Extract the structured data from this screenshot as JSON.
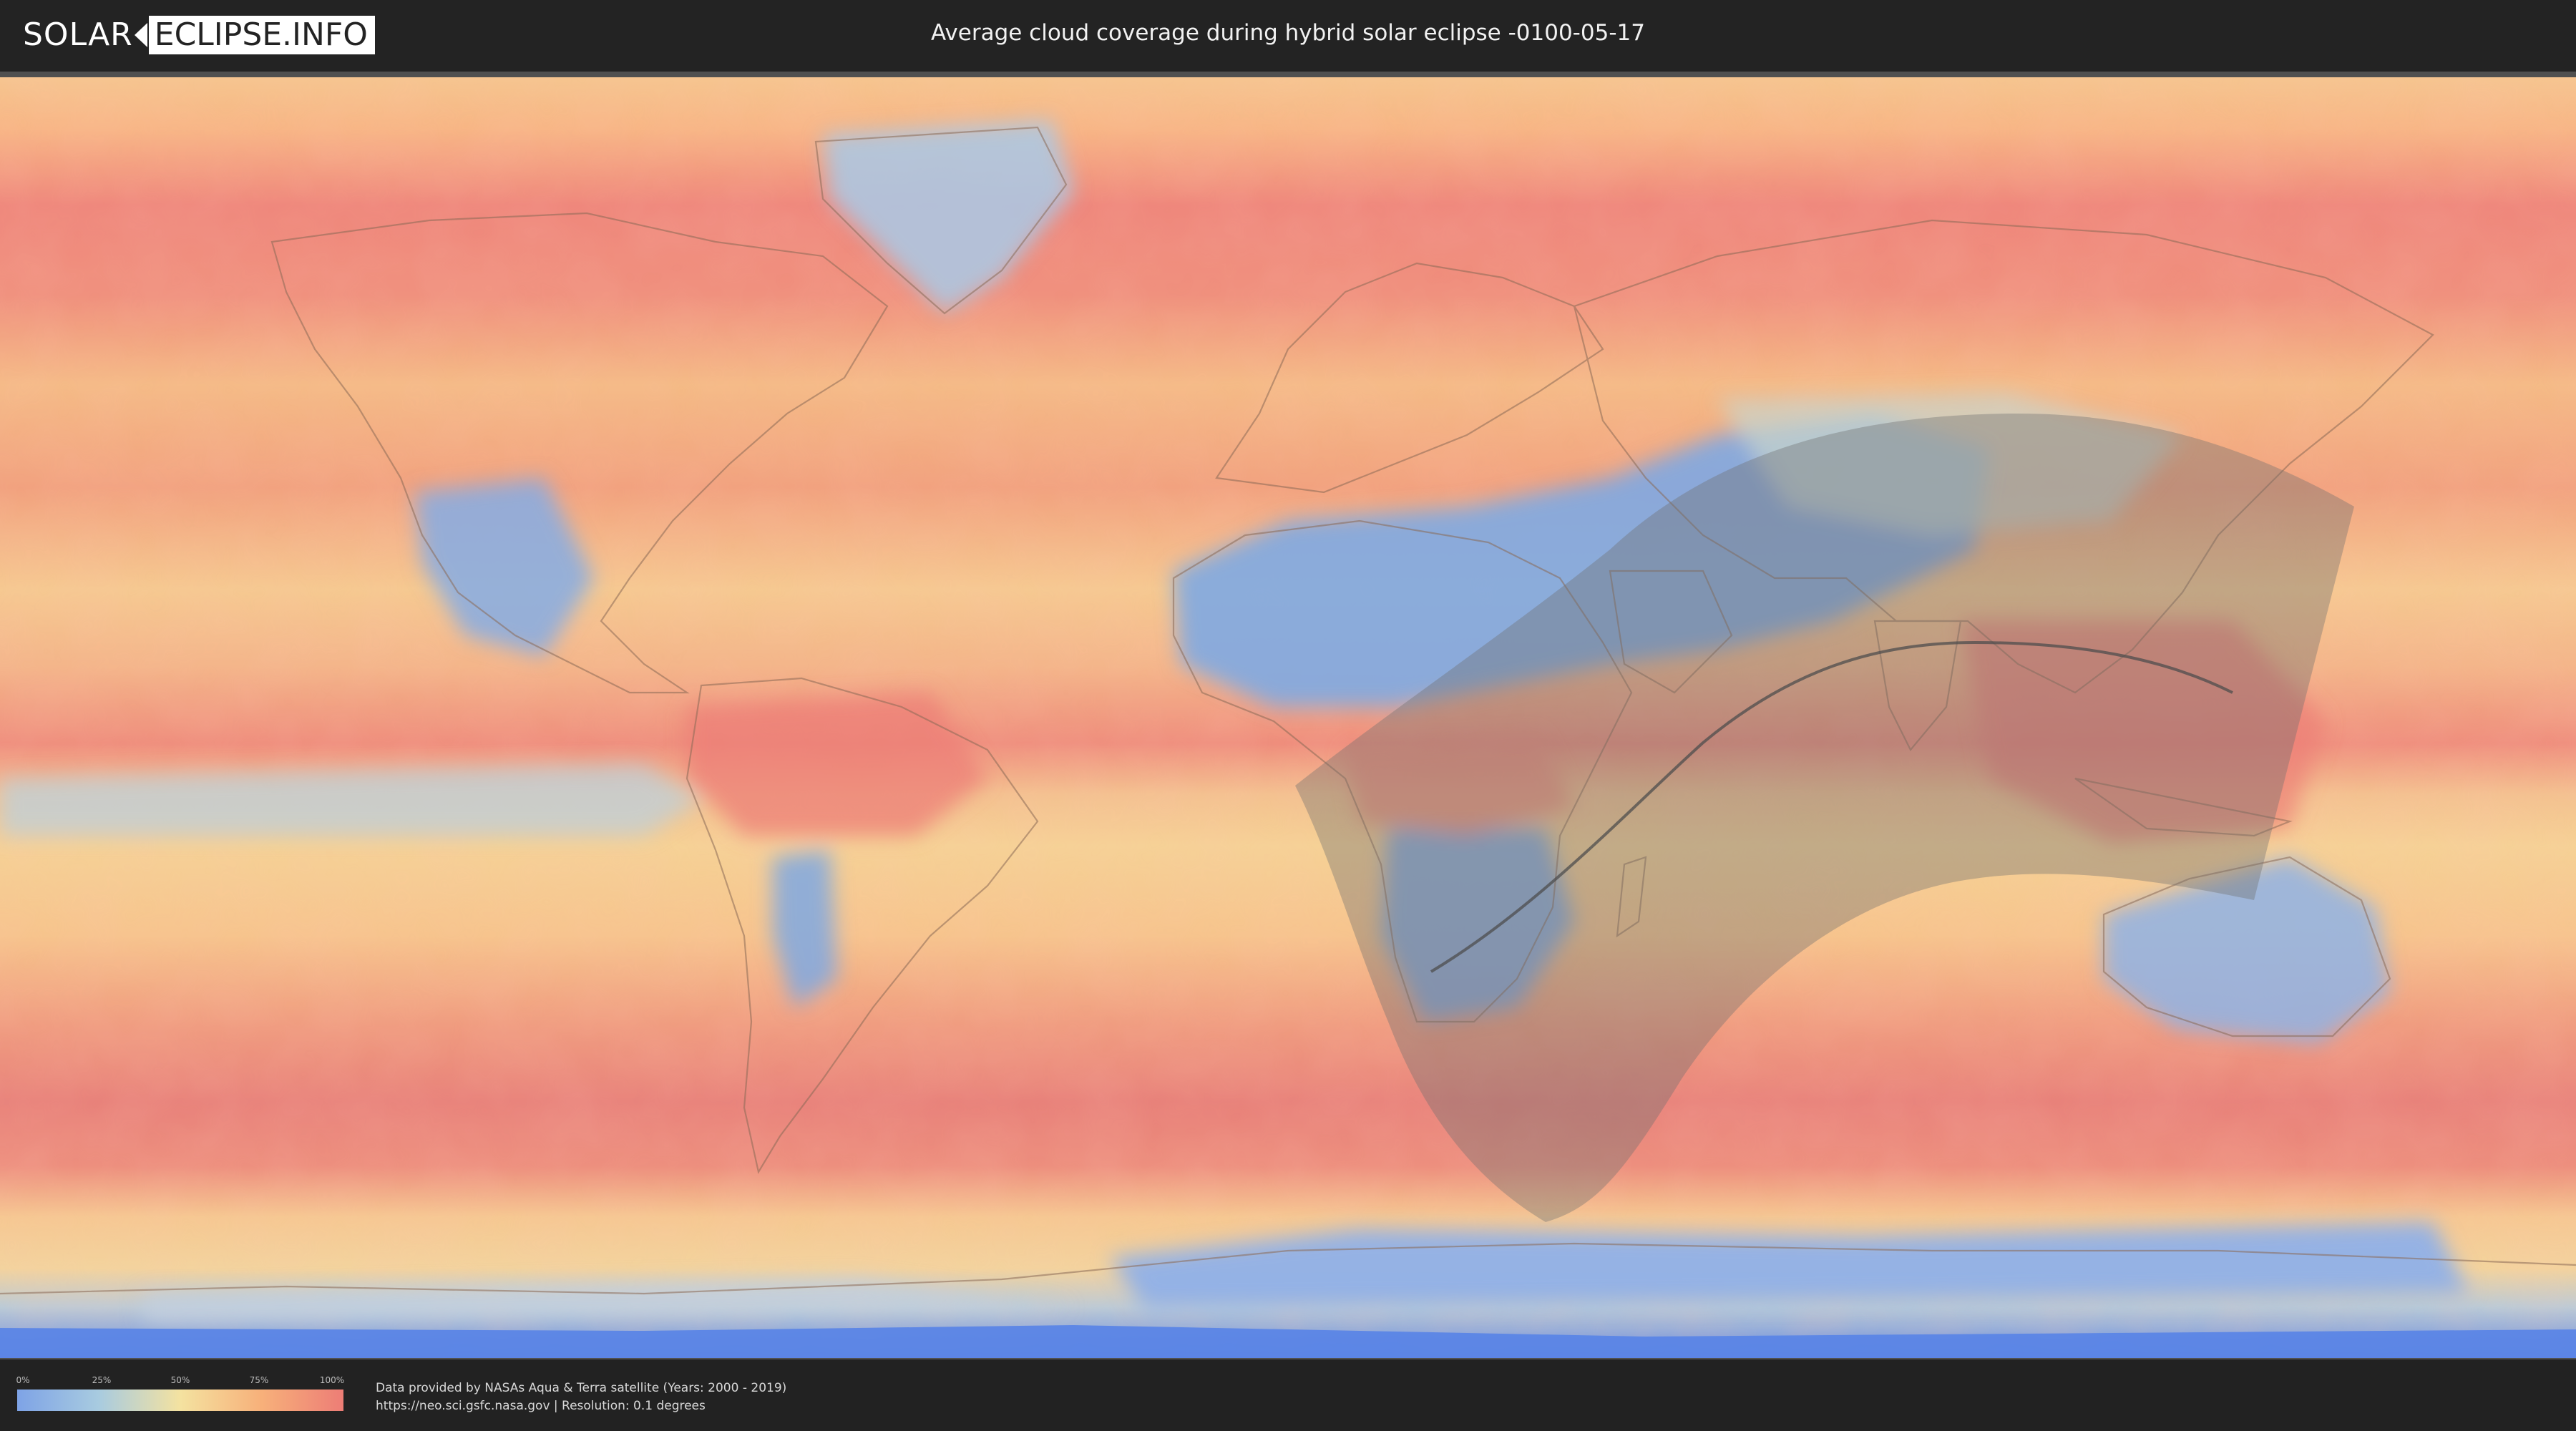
{
  "brand": {
    "part1": "SOLAR",
    "part2": "ECLIPSE.INFO"
  },
  "title": "Average cloud coverage during hybrid solar eclipse -0100-05-17",
  "colors": {
    "low": "#7ea3e6",
    "low_mid": "#a8cbe0",
    "mid": "#f4e2a0",
    "high_mid": "#f7b07a",
    "high": "#ed7d76",
    "header_bg": "#232323",
    "shadow_zone": "#7a7a7a",
    "central_line": "#505050"
  },
  "legend": {
    "ticks": [
      "0%",
      "25%",
      "50%",
      "75%",
      "100%"
    ],
    "tick_values": [
      0,
      25,
      50,
      75,
      100
    ]
  },
  "credit": {
    "line1": "Data provided by NASAs Aqua & Terra satellite (Years: 2000 - 2019)",
    "line2": "https://neo.sci.gsfc.nasa.gov | Resolution: 0.1 degrees"
  }
}
